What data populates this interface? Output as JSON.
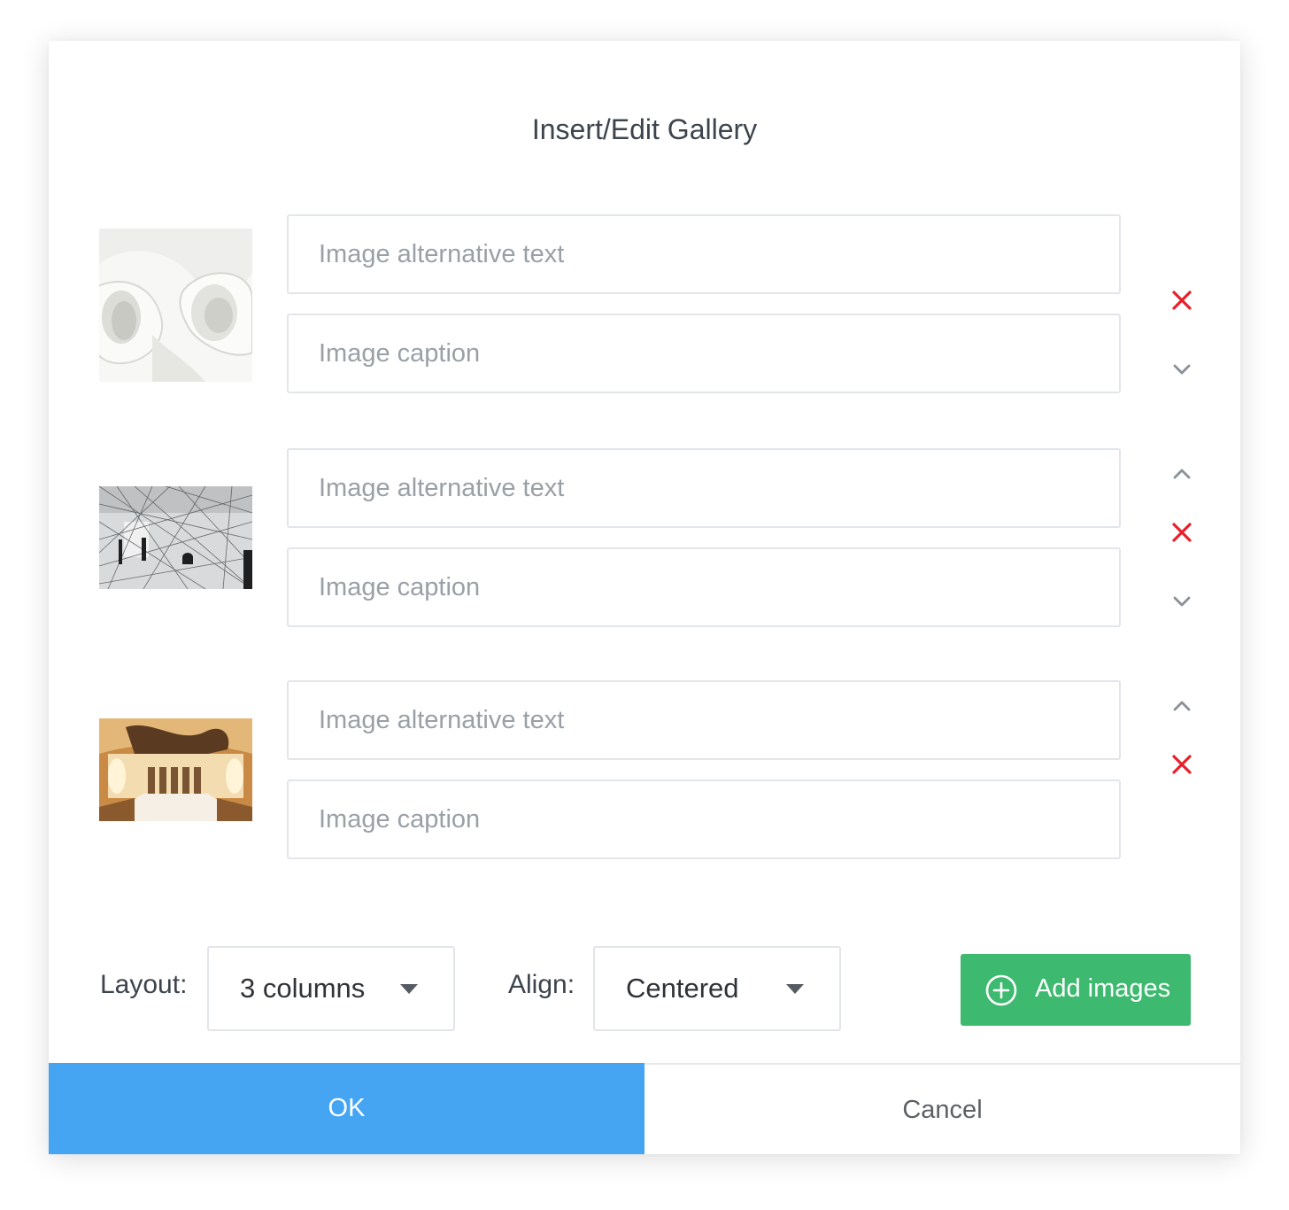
{
  "dialog": {
    "title": "Insert/Edit Gallery"
  },
  "images": [
    {
      "alt_value": "",
      "alt_placeholder": "Image alternative text",
      "caption_value": "",
      "caption_placeholder": "Image caption",
      "thumbnail": "white curved sculpture",
      "controls": [
        "remove-icon",
        "move-down-icon"
      ]
    },
    {
      "alt_value": "",
      "alt_placeholder": "Image alternative text",
      "caption_value": "",
      "caption_placeholder": "Image caption",
      "thumbnail": "string art installation with visitors",
      "controls": [
        "move-up-icon",
        "remove-icon",
        "move-down-icon"
      ]
    },
    {
      "alt_value": "",
      "alt_placeholder": "Image alternative text",
      "caption_value": "",
      "caption_placeholder": "Image caption",
      "thumbnail": "ornate museum hall interior",
      "controls": [
        "move-up-icon",
        "remove-icon"
      ]
    }
  ],
  "options": {
    "layout_label": "Layout:",
    "layout_value": "3 columns",
    "align_label": "Align:",
    "align_value": "Centered",
    "add_images_label": "Add images"
  },
  "footer": {
    "ok_label": "OK",
    "cancel_label": "Cancel"
  },
  "colors": {
    "ok_button": "#45a5f3",
    "add_button": "#3dba6f",
    "remove_icon": "#e8202a",
    "chevron_icon": "#8a9096"
  }
}
